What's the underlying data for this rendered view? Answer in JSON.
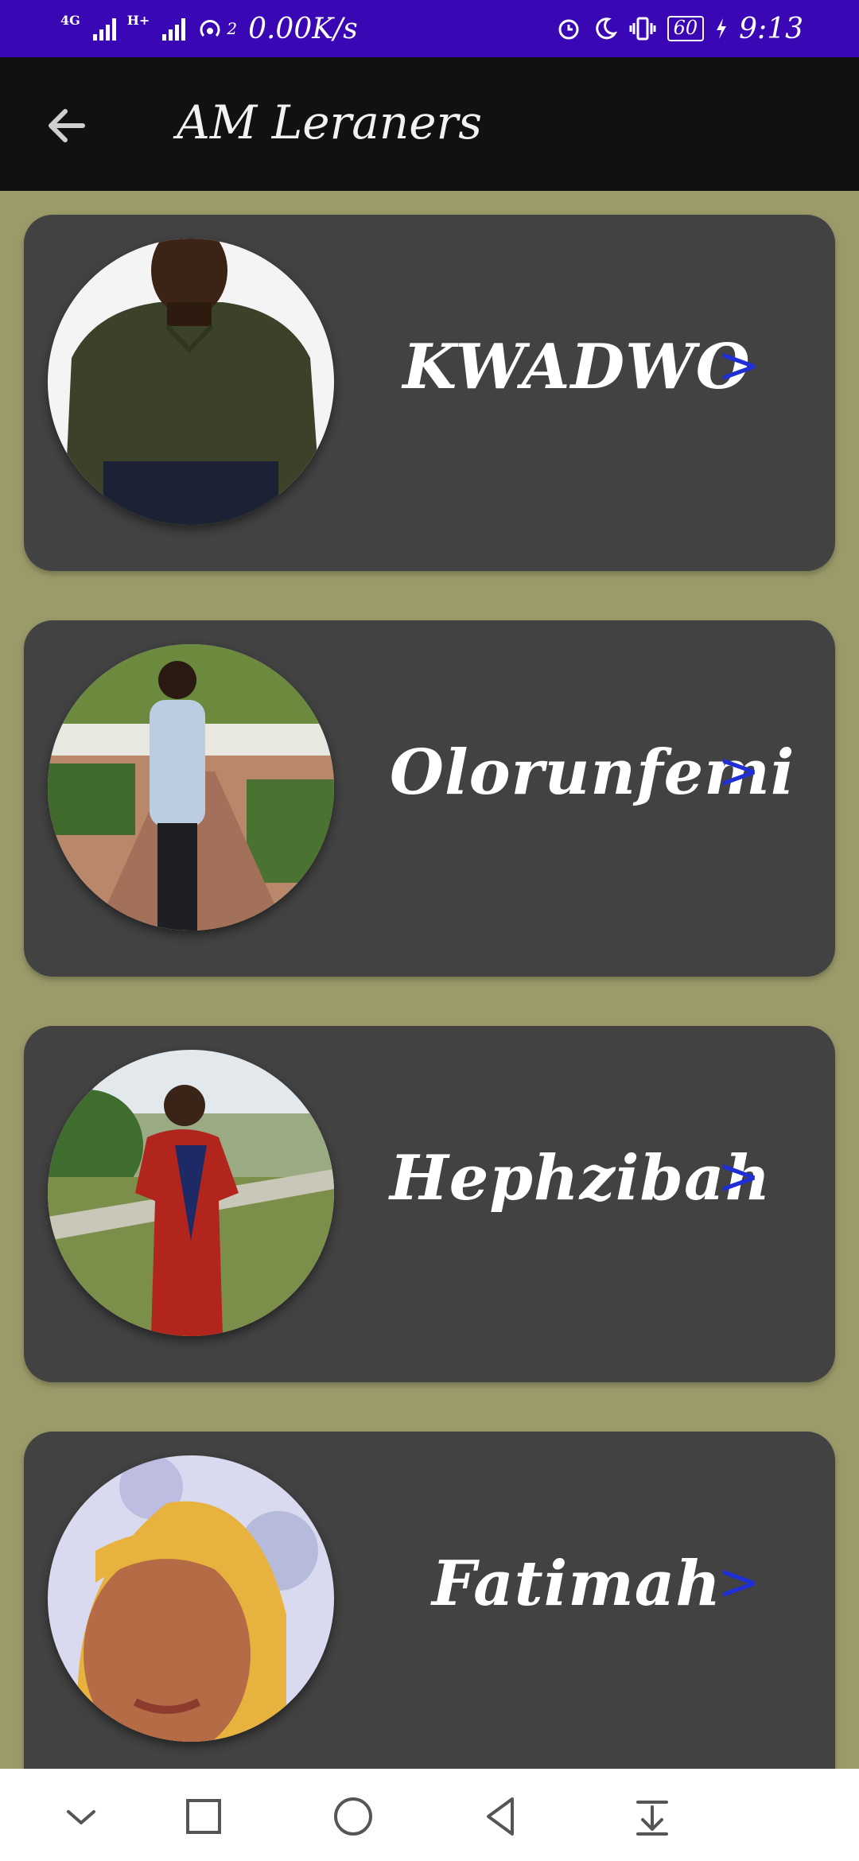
{
  "status_bar": {
    "net_speed": "0.00K/s",
    "hotspot_count": "2",
    "battery": "60",
    "time": "9:13",
    "icons": [
      "signal-4g-icon",
      "signal-h-icon",
      "hotspot-icon",
      "alarm-icon",
      "moon-icon",
      "vibrate-icon",
      "battery-icon",
      "charging-icon"
    ]
  },
  "app_bar": {
    "title": "AM Leraners",
    "back_icon": "arrow-left-icon"
  },
  "learners": [
    {
      "name": "KWADWO"
    },
    {
      "name": "Olorunfemi"
    },
    {
      "name": "Hephzibah"
    },
    {
      "name": "Fatimah"
    }
  ],
  "chevron": ">",
  "nav_bar": {
    "icons": [
      "collapse-icon",
      "recents-icon",
      "home-icon",
      "back-icon",
      "notifications-pull-icon"
    ]
  },
  "colors": {
    "status_bar": "#3a07b5",
    "app_bar": "#111111",
    "background": "#9b9b6a",
    "card": "#424242",
    "chevron": "#1e2fd6"
  }
}
